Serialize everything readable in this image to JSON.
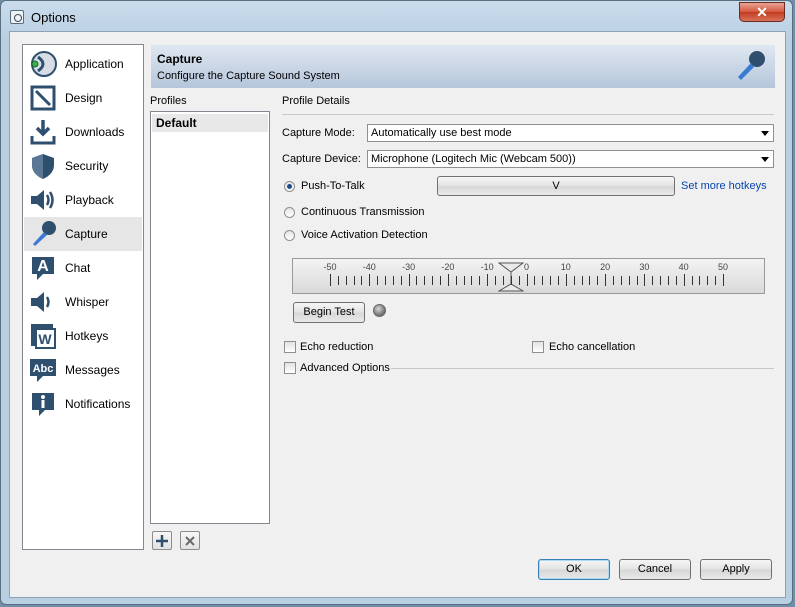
{
  "window": {
    "title": "Options",
    "close_label": "✕"
  },
  "sidebar": {
    "items": [
      {
        "label": "Application",
        "icon": "application-icon"
      },
      {
        "label": "Design",
        "icon": "design-icon"
      },
      {
        "label": "Downloads",
        "icon": "downloads-icon"
      },
      {
        "label": "Security",
        "icon": "security-icon"
      },
      {
        "label": "Playback",
        "icon": "playback-icon"
      },
      {
        "label": "Capture",
        "icon": "microphone-icon",
        "active": true
      },
      {
        "label": "Chat",
        "icon": "chat-icon"
      },
      {
        "label": "Whisper",
        "icon": "whisper-icon"
      },
      {
        "label": "Hotkeys",
        "icon": "hotkeys-icon"
      },
      {
        "label": "Messages",
        "icon": "messages-icon"
      },
      {
        "label": "Notifications",
        "icon": "notifications-icon"
      }
    ]
  },
  "header": {
    "title": "Capture",
    "subtitle": "Configure the Capture Sound System"
  },
  "profiles": {
    "label": "Profiles",
    "items": [
      "Default"
    ]
  },
  "details": {
    "label": "Profile Details",
    "capture_mode_label": "Capture Mode:",
    "capture_mode_value": "Automatically use best mode",
    "capture_device_label": "Capture Device:",
    "capture_device_value": "Microphone (Logitech Mic (Webcam 500))",
    "push_to_talk": "Push-To-Talk",
    "hotkey_value": "V",
    "set_more_hotkeys": "Set more hotkeys",
    "continuous": "Continuous Transmission",
    "vad": "Voice Activation Detection",
    "meter_ticks": [
      "-50",
      "-40",
      "-30",
      "-20",
      "-10",
      "0",
      "10",
      "20",
      "30",
      "40",
      "50"
    ],
    "begin_test": "Begin Test",
    "echo_reduction": "Echo reduction",
    "echo_cancellation": "Echo cancellation",
    "advanced_options": "Advanced Options"
  },
  "footer": {
    "ok": "OK",
    "cancel": "Cancel",
    "apply": "Apply"
  },
  "colors": {
    "accent": "#1a4d8c",
    "link": "#0645ad",
    "icon": "#2f4f6f"
  }
}
